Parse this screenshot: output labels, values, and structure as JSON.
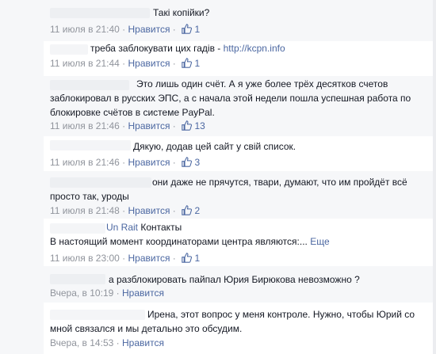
{
  "comments": [
    {
      "text": "Такі копійки?",
      "time": "11 июля в 21:40",
      "like_label": "Нравится",
      "likes": "1"
    },
    {
      "text": "треба заблокувати цих гадів - ",
      "link": "http://kcpn.info",
      "time": "11 июля в 21:44",
      "like_label": "Нравится",
      "likes": "1"
    },
    {
      "text": "Это лишь один счёт. А я уже более трёх десятков счетов заблокировал в русских ЭПС, а с начала этой недели пошла успешная работа по блокировке счётов в системе PayPal.",
      "time": "11 июля в 21:46",
      "like_label": "Нравится",
      "likes": "13"
    },
    {
      "text": "Дякую, додав цей сайт у свій список.",
      "time": "11 июля в 21:46",
      "like_label": "Нравится",
      "likes": "3"
    },
    {
      "text": "они даже не прячутся, твари, думают, что им пройдёт всё просто так, уроды",
      "time": "11 июля в 21:48",
      "like_label": "Нравится",
      "likes": "2"
    },
    {
      "author": "Un Rait",
      "author_suffix": "Контакты",
      "text": "В настоящий момент координаторами центра являются:...",
      "more": "Еще",
      "time": "11 июля в 23:00",
      "like_label": "Нравится",
      "likes": "1"
    },
    {
      "text": "а разблокировать пайпал Юрия Бирюкова невозможно ?",
      "time": "Вчера, в 10:19",
      "like_label": "Нравится"
    },
    {
      "text": "Ирена, этот вопрос у меня контроле. Нужно, чтобы Юрий со мной связался и мы детально это обсудим.",
      "time": "Вчера, в 14:53",
      "like_label": "Нравится"
    }
  ],
  "separator": "·",
  "colors": {
    "link": "#4b67a1",
    "meta": "#90949c",
    "text": "#141823",
    "bg_alt": "#f6f7f9"
  },
  "icons": {
    "like": "thumbs-up-icon"
  }
}
